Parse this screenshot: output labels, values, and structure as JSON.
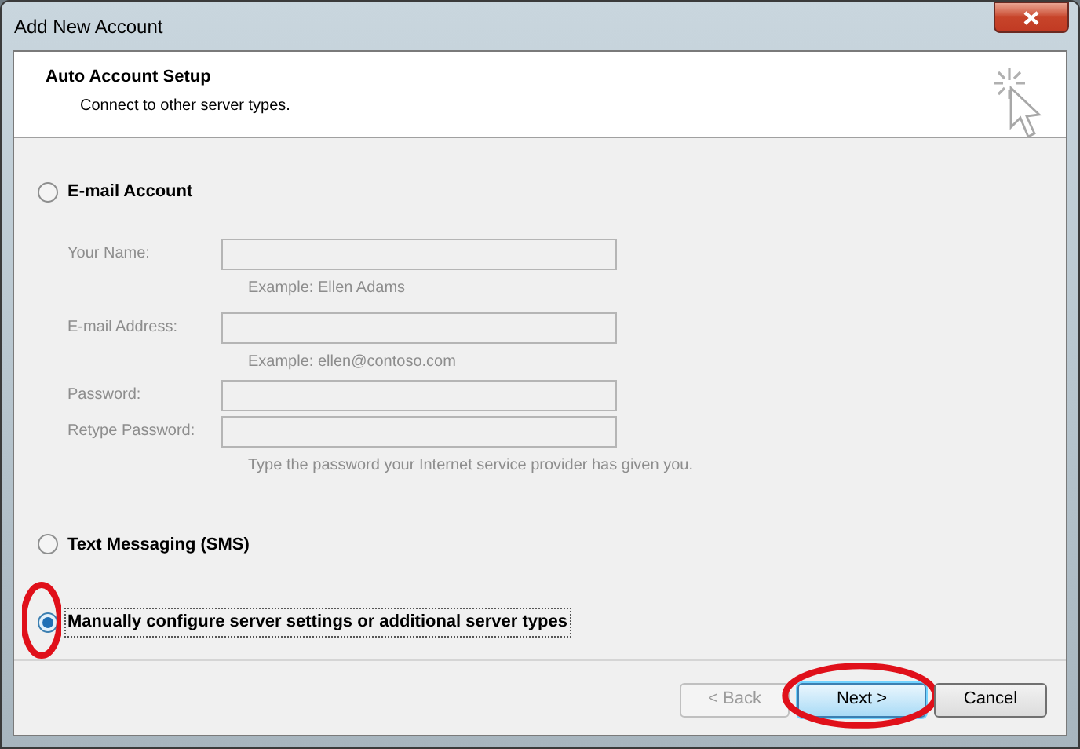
{
  "window": {
    "title": "Add New Account"
  },
  "header": {
    "title": "Auto Account Setup",
    "subtitle": "Connect to other server types."
  },
  "options": [
    {
      "label": "E-mail Account",
      "selected": false,
      "fields_disabled": true,
      "fields": [
        {
          "label": "Your Name:",
          "hint": "Example: Ellen Adams"
        },
        {
          "label": "E-mail Address:",
          "hint": "Example: ellen@contoso.com"
        },
        {
          "label": "Password:"
        },
        {
          "label": "Retype Password:",
          "hint": "Type the password your Internet service provider has given you."
        }
      ]
    },
    {
      "label": "Text Messaging (SMS)",
      "selected": false
    },
    {
      "label": "Manually configure server settings or additional server types",
      "selected": true,
      "focused": true,
      "circled": true
    }
  ],
  "buttons": [
    {
      "label": "< Back",
      "disabled": true,
      "default": false,
      "circled": false
    },
    {
      "label": "Next >",
      "disabled": false,
      "default": true,
      "circled": true
    },
    {
      "label": "Cancel",
      "disabled": false,
      "default": false,
      "circled": false
    }
  ]
}
